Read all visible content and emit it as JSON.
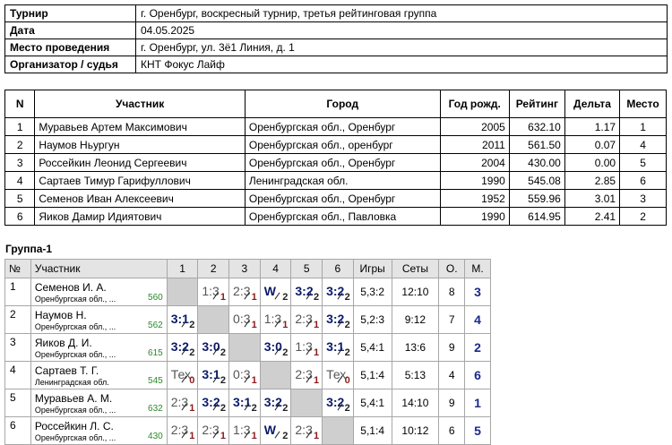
{
  "info": [
    {
      "label": "Турнир",
      "value": "г. Оренбург, воскресный турнир, третья рейтинговая группа"
    },
    {
      "label": "Дата",
      "value": "04.05.2025"
    },
    {
      "label": "Место проведения",
      "value": "г. Оренбург, ул. 3ё1 Линия, д. 1"
    },
    {
      "label": "Организатор / судья",
      "value": "КНТ Фокус Лайф"
    }
  ],
  "participants": {
    "headers": [
      "N",
      "Участник",
      "Город",
      "Год рожд.",
      "Рейтинг",
      "Дельта",
      "Место"
    ],
    "rows": [
      [
        "1",
        "Муравьев Артем Максимович",
        "Оренбургская обл., Оренбург",
        "2005",
        "632.10",
        "1.17",
        "1"
      ],
      [
        "2",
        "Наумов Ньургун",
        "Оренбургская обл., оренбург",
        "2011",
        "561.50",
        "0.07",
        "4"
      ],
      [
        "3",
        "Россейкин Леонид Сергеевич",
        "Оренбургская обл., Оренбург",
        "2004",
        "430.00",
        "0.00",
        "5"
      ],
      [
        "4",
        "Сартаев Тимур Гарифуллович",
        "Ленинградская обл.",
        "1990",
        "545.08",
        "2.85",
        "6"
      ],
      [
        "5",
        "Семенов Иван Алексеевич",
        "Оренбургская обл., Оренбург",
        "1952",
        "559.96",
        "3.01",
        "3"
      ],
      [
        "6",
        "Яиков Дамир Идиятович",
        "Оренбургская обл., Павловка",
        "1990",
        "614.95",
        "2.41",
        "2"
      ]
    ]
  },
  "group": {
    "title": "Группа-1",
    "headers": {
      "num": "№",
      "player": "Участник",
      "cols": [
        "1",
        "2",
        "3",
        "4",
        "5",
        "6"
      ],
      "games": "Игры",
      "sets": "Сеты",
      "points": "О.",
      "place": "М."
    },
    "rows": [
      {
        "num": "1",
        "name": "Семенов И. А.",
        "city": "Оренбургская обл., ...",
        "rating": "560",
        "cells": [
          null,
          {
            "s": "1:3",
            "p": "1",
            "t": "loss"
          },
          {
            "s": "2:3",
            "p": "1",
            "t": "loss"
          },
          {
            "s": "W",
            "p": "2",
            "t": "win"
          },
          {
            "s": "3:2",
            "p": "2",
            "t": "win"
          },
          {
            "s": "3:2",
            "p": "2",
            "t": "win"
          }
        ],
        "games": "5,3:2",
        "sets": "12:10",
        "points": "8",
        "place": "3"
      },
      {
        "num": "2",
        "name": "Наумов Н.",
        "city": "Оренбургская обл., ...",
        "rating": "562",
        "cells": [
          {
            "s": "3:1",
            "p": "2",
            "t": "win"
          },
          null,
          {
            "s": "0:3",
            "p": "1",
            "t": "loss"
          },
          {
            "s": "1:3",
            "p": "1",
            "t": "loss"
          },
          {
            "s": "2:3",
            "p": "1",
            "t": "loss"
          },
          {
            "s": "3:2",
            "p": "2",
            "t": "win"
          }
        ],
        "games": "5,2:3",
        "sets": "9:12",
        "points": "7",
        "place": "4"
      },
      {
        "num": "3",
        "name": "Яиков Д. И.",
        "city": "Оренбургская обл., ...",
        "rating": "615",
        "cells": [
          {
            "s": "3:2",
            "p": "2",
            "t": "win"
          },
          {
            "s": "3:0",
            "p": "2",
            "t": "win"
          },
          null,
          {
            "s": "3:0",
            "p": "2",
            "t": "win"
          },
          {
            "s": "1:3",
            "p": "1",
            "t": "loss"
          },
          {
            "s": "3:1",
            "p": "2",
            "t": "win"
          }
        ],
        "games": "5,4:1",
        "sets": "13:6",
        "points": "9",
        "place": "2"
      },
      {
        "num": "4",
        "name": "Сартаев Т. Г.",
        "city": "Ленинградская обл.",
        "rating": "545",
        "cells": [
          {
            "s": "Тех",
            "p": "0",
            "t": "loss"
          },
          {
            "s": "3:1",
            "p": "2",
            "t": "win"
          },
          {
            "s": "0:3",
            "p": "1",
            "t": "loss"
          },
          null,
          {
            "s": "2:3",
            "p": "1",
            "t": "loss"
          },
          {
            "s": "Тех",
            "p": "0",
            "t": "loss"
          }
        ],
        "games": "5,1:4",
        "sets": "5:13",
        "points": "4",
        "place": "6"
      },
      {
        "num": "5",
        "name": "Муравьев А. М.",
        "city": "Оренбургская обл., ...",
        "rating": "632",
        "cells": [
          {
            "s": "2:3",
            "p": "1",
            "t": "loss"
          },
          {
            "s": "3:2",
            "p": "2",
            "t": "win"
          },
          {
            "s": "3:1",
            "p": "2",
            "t": "win"
          },
          {
            "s": "3:2",
            "p": "2",
            "t": "win"
          },
          null,
          {
            "s": "3:2",
            "p": "2",
            "t": "win"
          }
        ],
        "games": "5,4:1",
        "sets": "14:10",
        "points": "9",
        "place": "1"
      },
      {
        "num": "6",
        "name": "Россейкин Л. С.",
        "city": "Оренбургская обл., ...",
        "rating": "430",
        "cells": [
          {
            "s": "2:3",
            "p": "1",
            "t": "loss"
          },
          {
            "s": "2:3",
            "p": "1",
            "t": "loss"
          },
          {
            "s": "1:3",
            "p": "1",
            "t": "loss"
          },
          {
            "s": "W",
            "p": "2",
            "t": "win"
          },
          {
            "s": "2:3",
            "p": "1",
            "t": "loss"
          },
          null
        ],
        "games": "5,1:4",
        "sets": "10:12",
        "points": "6",
        "place": "5"
      }
    ]
  }
}
